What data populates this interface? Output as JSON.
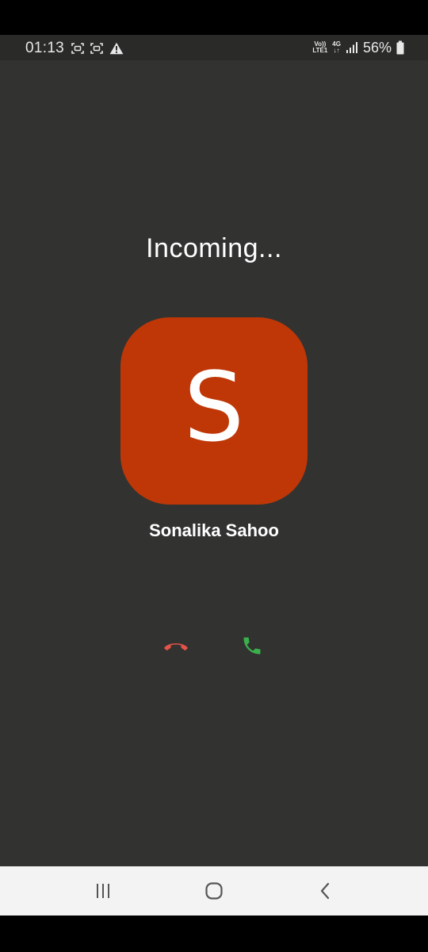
{
  "status_bar": {
    "time": "01:13",
    "volte_top": "Vo))",
    "volte_bottom": "LTE1",
    "network_type": "4G",
    "network_arrows": "↓↑",
    "battery_percent": "56%",
    "left_icons": [
      "screenshot-icon",
      "screenshot-icon",
      "warning-icon"
    ],
    "right_icons": [
      "volte-icon",
      "4g-icon",
      "signal-icon",
      "battery-icon"
    ]
  },
  "call": {
    "status": "Incoming...",
    "avatar_letter": "S",
    "caller_name": "Sonalika Sahoo",
    "avatar_color": "#bf3707",
    "decline_color": "#e5524a",
    "answer_color": "#3bb04a"
  },
  "nav_bar": {
    "buttons": [
      "recent-apps",
      "home",
      "back"
    ]
  },
  "colors": {
    "background": "#323331",
    "status_bar": "#2a2b29",
    "nav_bar": "#f3f3f3"
  }
}
